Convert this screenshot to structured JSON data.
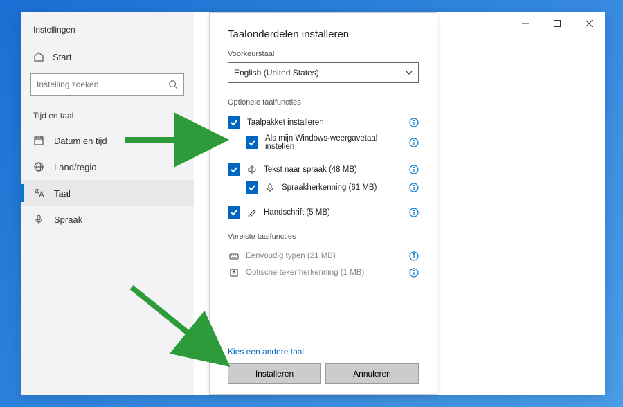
{
  "window": {
    "title": "Instellingen"
  },
  "sidebar": {
    "home": "Start",
    "search_placeholder": "Instelling zoeken",
    "section": "Tijd en taal",
    "items": [
      {
        "label": "Datum en tijd"
      },
      {
        "label": "Land/regio"
      },
      {
        "label": "Taal"
      },
      {
        "label": "Spraak"
      }
    ]
  },
  "modal": {
    "title": "Taalonderdelen installeren",
    "pref_lang_label": "Voorkeurstaal",
    "selected_language": "English (United States)",
    "optional_section": "Optionele taalfuncties",
    "features": {
      "install_pack": "Taalpakket installeren",
      "set_display": "Als mijn Windows-weergavetaal instellen",
      "tts": "Tekst naar spraak (48 MB)",
      "speech_rec": "Spraakherkenning (61 MB)",
      "handwriting": "Handschrift (5 MB)"
    },
    "required_section": "Vereiste taalfuncties",
    "required": {
      "basic_typing": "Eenvoudig typen (21 MB)",
      "ocr": "Optische tekenherkenning (1 MB)"
    },
    "choose_other": "Kies een andere taal",
    "install_btn": "Installeren",
    "cancel_btn": "Annuleren"
  }
}
